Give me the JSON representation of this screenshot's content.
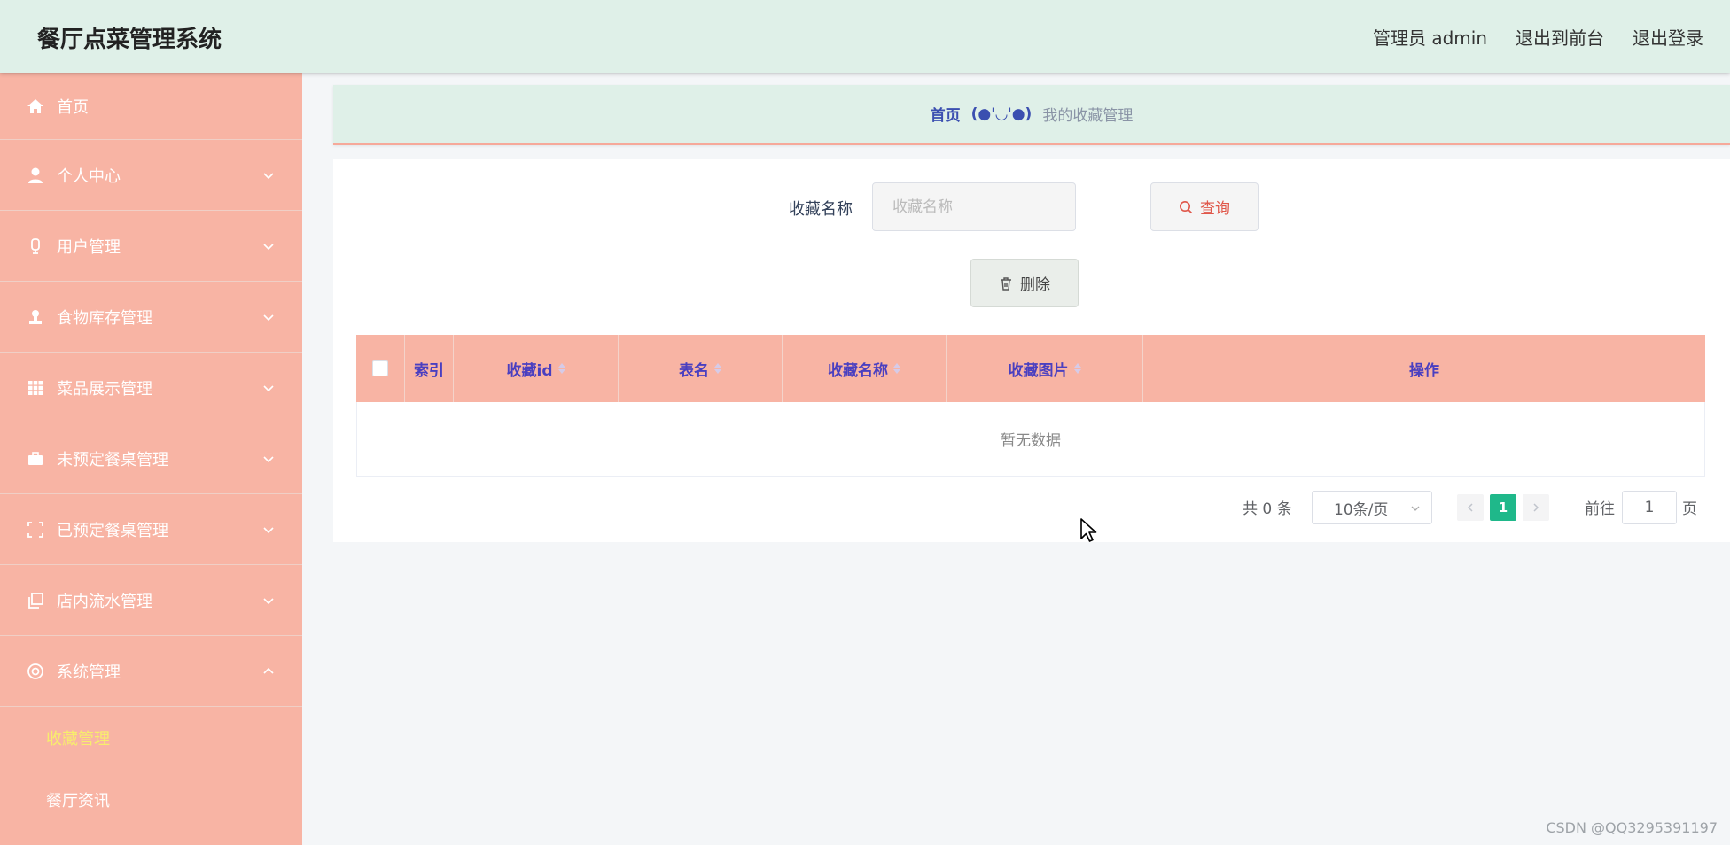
{
  "header": {
    "app_title": "餐厅点菜管理系统",
    "admin_label": "管理员 admin",
    "exit_front": "退出到前台",
    "logout": "退出登录"
  },
  "sidebar": {
    "items": [
      {
        "label": "首页",
        "icon": "home-icon"
      },
      {
        "label": "个人中心",
        "icon": "user-icon"
      },
      {
        "label": "用户管理",
        "icon": "phone-icon"
      },
      {
        "label": "食物库存管理",
        "icon": "stamp-icon"
      },
      {
        "label": "菜品展示管理",
        "icon": "grid-icon"
      },
      {
        "label": "未预定餐桌管理",
        "icon": "briefcase-icon"
      },
      {
        "label": "已预定餐桌管理",
        "icon": "frame-icon"
      },
      {
        "label": "店内流水管理",
        "icon": "copy-icon"
      },
      {
        "label": "系统管理",
        "icon": "lifebuoy-icon"
      }
    ],
    "submenu": [
      {
        "label": "收藏管理",
        "active": true
      },
      {
        "label": "餐厅资讯",
        "active": false
      }
    ]
  },
  "breadcrumb": {
    "home": "首页",
    "separator": "(●'◡'●)",
    "current": "我的收藏管理"
  },
  "search": {
    "label": "收藏名称",
    "placeholder": "收藏名称",
    "query_button": "查询"
  },
  "toolbar": {
    "delete_button": "删除"
  },
  "table": {
    "columns": [
      "索引",
      "收藏id",
      "表名",
      "收藏名称",
      "收藏图片",
      "操作"
    ],
    "empty_text": "暂无数据"
  },
  "pagination": {
    "total": "共 0 条",
    "page_size": "10条/页",
    "current_page": "1",
    "goto_label": "前往",
    "goto_value": "1",
    "page_unit": "页"
  },
  "watermark": "CSDN @QQ3295391197",
  "colors": {
    "header_bg": "#dff0e8",
    "sidebar_bg": "#f8b4a4",
    "accent_green": "#1fb88a",
    "heading_blue": "#4a3fc0",
    "active_submenu": "#f7ee6c"
  }
}
